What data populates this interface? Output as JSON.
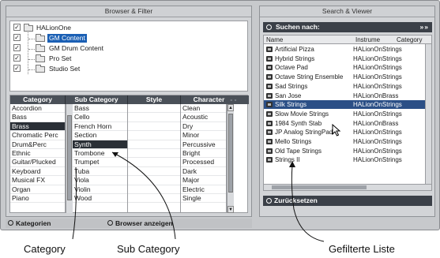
{
  "browser_panel": {
    "title": "Browser & Filter"
  },
  "tree": {
    "root": {
      "label": "HALionOne",
      "checked": true
    },
    "children": [
      {
        "label": "GM Content",
        "checked": true,
        "selected": true
      },
      {
        "label": "GM Drum Content",
        "checked": true,
        "selected": false
      },
      {
        "label": "Pro Set",
        "checked": true,
        "selected": false
      },
      {
        "label": "Studio Set",
        "checked": true,
        "selected": false
      }
    ]
  },
  "filter": {
    "headers": {
      "category": "Category",
      "sub_category": "Sub Category",
      "style": "Style",
      "character": "Character"
    },
    "category_items": [
      "Accordion",
      "Bass",
      "Brass",
      "Chromatic Perc",
      "Drum&Perc",
      "Ethnic",
      "Guitar/Plucked",
      "Keyboard",
      "Musical FX",
      "Organ",
      "Piano"
    ],
    "category_selected": "Brass",
    "sub_category_items": [
      "Bass",
      "Cello",
      "French Horn",
      "Section",
      "Synth",
      "Trombone",
      "Trumpet",
      "Tuba",
      "Viola",
      "Violin",
      "Wood"
    ],
    "sub_category_selected": "Synth",
    "character_items": [
      "Clean",
      "Acoustic",
      "Dry",
      "Minor",
      "Percussive",
      "Bright",
      "Processed",
      "Dark",
      "Major",
      "Electric",
      "Single"
    ]
  },
  "bottom": {
    "categories_label": "Kategorien",
    "browser_label": "Browser anzeigen"
  },
  "search_panel": {
    "title": "Search & Viewer",
    "search_label": "Suchen nach:",
    "menu_dots": "»»",
    "columns": {
      "name": "Name",
      "instrument": "Instrume",
      "category": "Category"
    },
    "results": [
      {
        "name": "Artificial Pizza",
        "instrument": "HALionOnStrings"
      },
      {
        "name": "Hybrid Strings",
        "instrument": "HALionOnStrings"
      },
      {
        "name": "Octave Pad",
        "instrument": "HALionOnStrings"
      },
      {
        "name": "Octave String Ensemble",
        "instrument": "HALionOnStrings"
      },
      {
        "name": "Sad Strings",
        "instrument": "HALionOnStrings"
      },
      {
        "name": "San Jose",
        "instrument": "HALionOnBrass"
      },
      {
        "name": "Silk Strings",
        "instrument": "HALionOnStrings",
        "selected": true
      },
      {
        "name": "Slow Movie Strings",
        "instrument": "HALionOnStrings"
      },
      {
        "name": "1984 Synth Stab",
        "instrument": "HALionOnBrass"
      },
      {
        "name": "JP Analog StringPad",
        "instrument": "HALionOnStrings"
      },
      {
        "name": "Mello Strings",
        "instrument": "HALionOnStrings"
      },
      {
        "name": "Old Tape Strings",
        "instrument": "HALionOnStrings"
      },
      {
        "name": "Strings II",
        "instrument": "HALionOnStrings"
      }
    ],
    "reset_label": "Zurücksetzen"
  },
  "callouts": {
    "category": "Category",
    "sub_category": "Sub Category",
    "filtered_list": "Gefilterte Liste"
  }
}
